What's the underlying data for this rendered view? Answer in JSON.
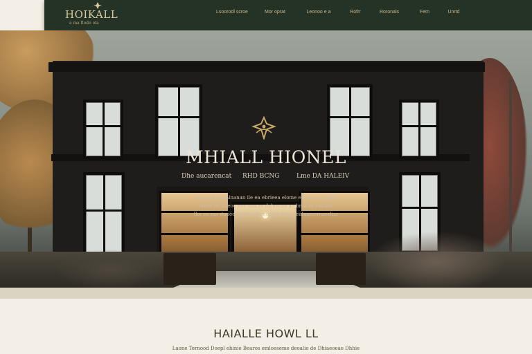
{
  "header": {
    "logo_text": "HOIKALL",
    "logo_tagline": "a ma flode ola",
    "nav": [
      "Lsoorodl scroe",
      "Mor oprat",
      "Leonoo e a",
      "Rofrr",
      "Roronals",
      "Fem",
      "Unrtd"
    ]
  },
  "hero": {
    "title": "MHIALL HIONEL",
    "subtitle_left": "Dhe aucarencat",
    "subtitle_mid": "RHD BCNG",
    "subtitle_right": "Lme DA HALEIV",
    "description": [
      "Ine ee  bealnalnanan ile ea ebrieea elome elnaa ab d pare",
      "Ihere be dneoo eee ona re daleecne ae bnia ae ealiaoe",
      "Ihe ee ear duueeo alomaaeeeoarao leoe aealanmerraeeliar"
    ]
  },
  "section": {
    "title": "HAIALLE HOWL LL",
    "text": "Laone Ternood Doepl ehinie Bearos emloeseme deoalio de Dhiaeoeae Dhhie"
  },
  "colors": {
    "header_bg": "#253326",
    "accent_gold": "#d8c79c",
    "page_bg": "#f3efe6"
  }
}
